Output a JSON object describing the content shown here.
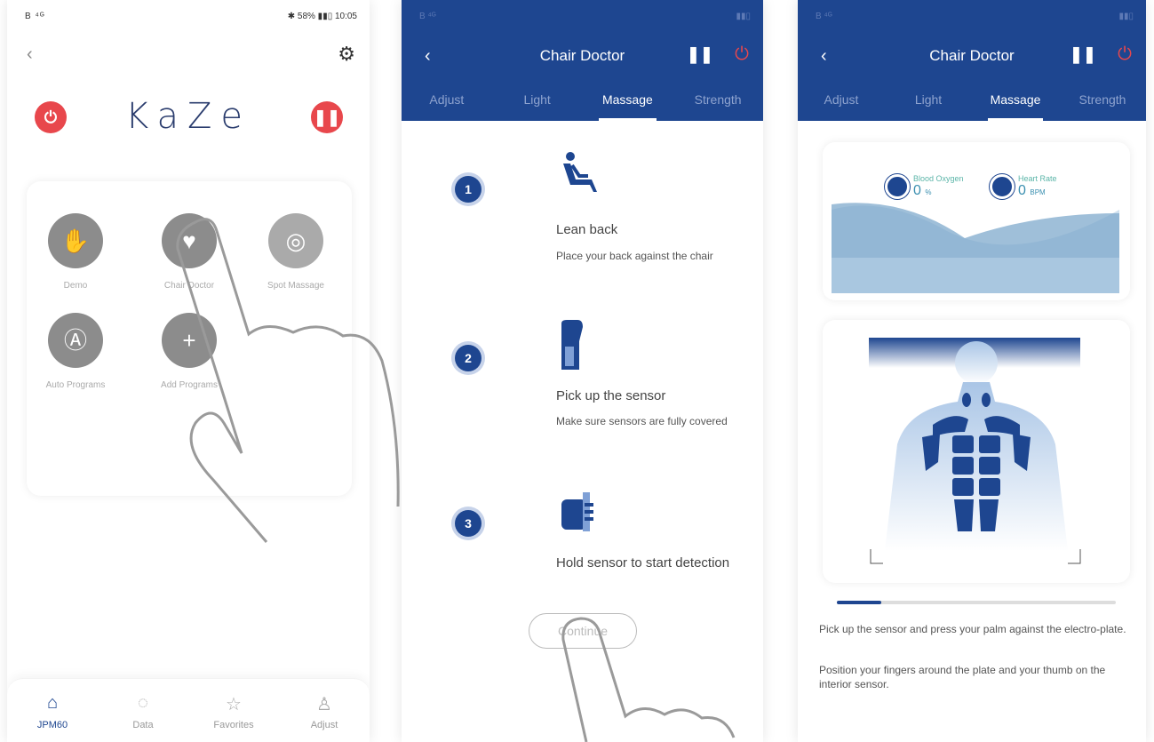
{
  "screen1": {
    "status_left": "B ⁴ᴳ",
    "status_right": "✱ 58% ▮▮▯ 10:05",
    "brand": "KaZe",
    "functions": [
      {
        "label": "Demo",
        "icon": "✋"
      },
      {
        "label": "Chair Doctor",
        "icon": "♥"
      },
      {
        "label": "Spot Massage",
        "icon": "◎"
      },
      {
        "label": "Auto Programs",
        "icon": "Ⓐ"
      },
      {
        "label": "Add Programs",
        "icon": "+"
      }
    ],
    "nav": [
      {
        "label": "JPM60",
        "icon": "⌂"
      },
      {
        "label": "Data",
        "icon": "◌"
      },
      {
        "label": "Favorites",
        "icon": "☆"
      },
      {
        "label": "Adjust",
        "icon": "♙"
      }
    ]
  },
  "screen2": {
    "title": "Chair Doctor",
    "tabs": [
      "Adjust",
      "Light",
      "Massage",
      "Strength"
    ],
    "active_tab": "Massage",
    "steps": [
      {
        "num": "1",
        "title": "Lean back",
        "desc": "Place your back against the chair"
      },
      {
        "num": "2",
        "title": "Pick up the sensor",
        "desc": "Make sure sensors are fully covered"
      },
      {
        "num": "3",
        "title": "Hold sensor to start detection",
        "desc": ""
      }
    ],
    "continue_label": "Continue"
  },
  "screen3": {
    "title": "Chair Doctor",
    "tabs": [
      "Adjust",
      "Light",
      "Massage",
      "Strength"
    ],
    "active_tab": "Massage",
    "blood_oxygen_label": "Blood Oxygen",
    "blood_oxygen_value": "0",
    "blood_oxygen_unit": "%",
    "heart_rate_label": "Heart Rate",
    "heart_rate_value": "0",
    "heart_rate_unit": "BPM",
    "progress": 0.16,
    "instruction_1": "Pick up the sensor and press your palm against the electro-plate.",
    "instruction_2": "Position your fingers around the plate and your thumb on the interior sensor."
  },
  "colors": {
    "brand_blue": "#1e4690",
    "accent_red": "#e8474c",
    "function_gray": "#8c8c8c",
    "wave_light": "#cfe0ee",
    "wave_dark": "#7fa9cc"
  }
}
